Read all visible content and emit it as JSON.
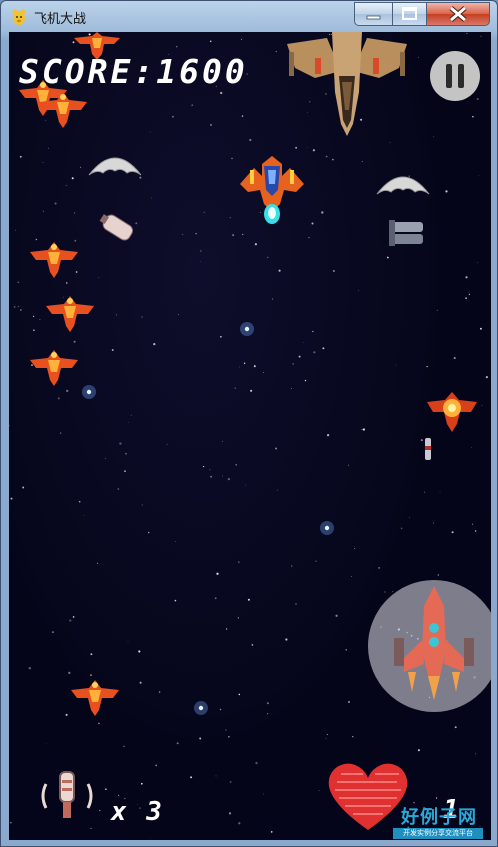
{
  "window": {
    "title": "飞机大战"
  },
  "hud": {
    "score_label": "SCORE:",
    "score_value": "1600",
    "lives_text": "x 3",
    "bomb_count": "1"
  },
  "watermark": {
    "title": "好例子网",
    "subtitle": "开发实例分享交流平台"
  },
  "colors": {
    "background": "#05051a",
    "enemy_orange": "#e8511f",
    "bullet_cyan": "#35e0e8",
    "heart_red": "#e03030"
  },
  "icons": [
    "pygame-icon",
    "minimize-icon",
    "maximize-icon",
    "close-icon",
    "pause-icon",
    "bomb-icon",
    "heart-icon",
    "life-plane-icon"
  ]
}
